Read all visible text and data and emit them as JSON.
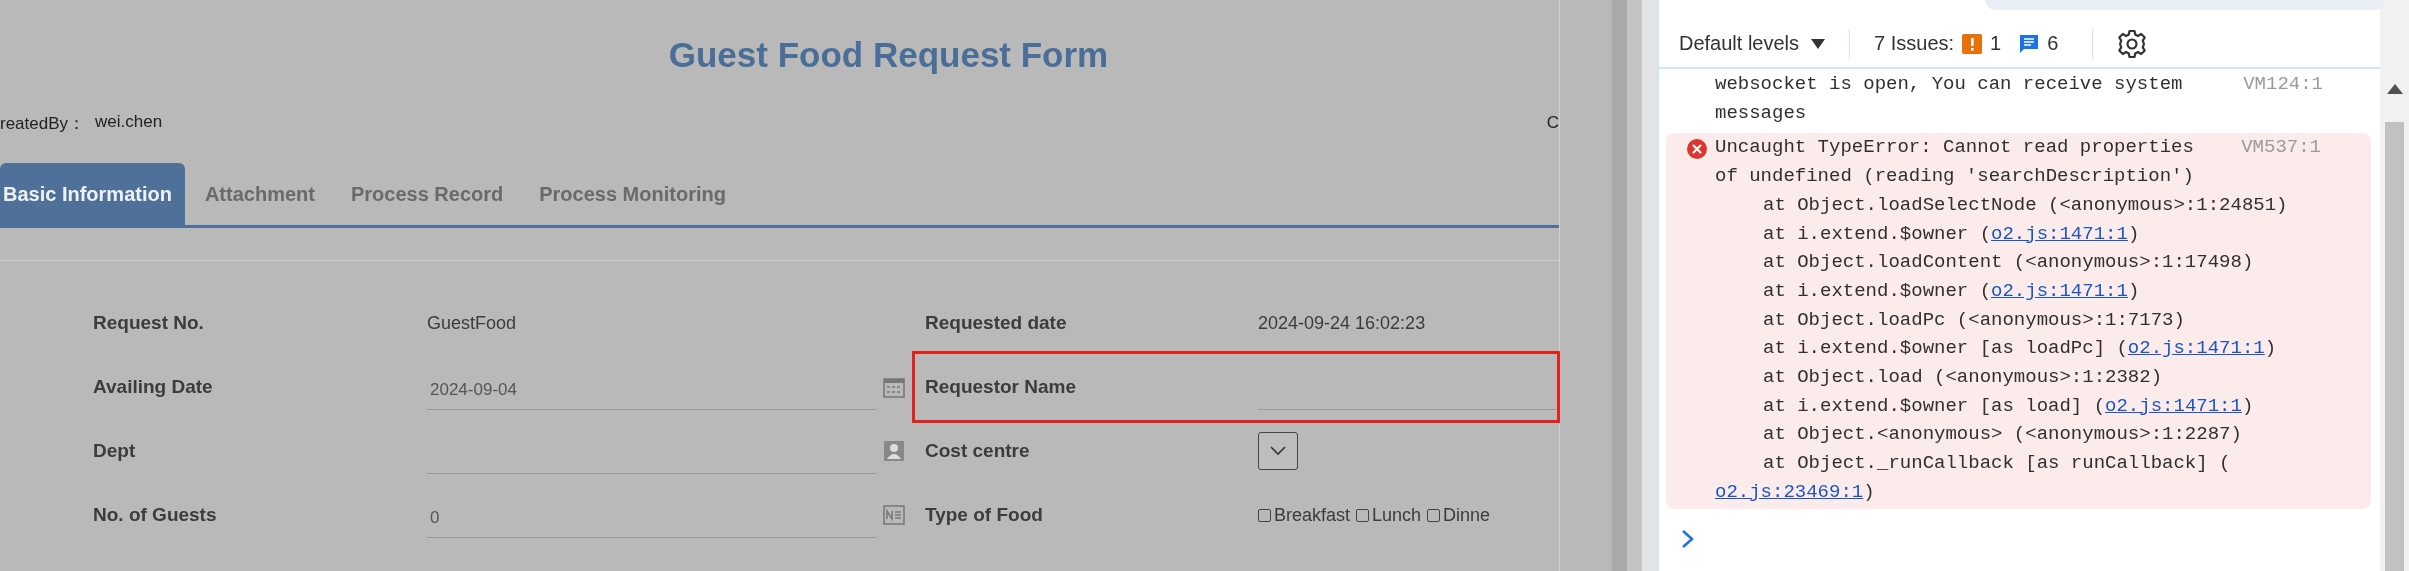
{
  "form": {
    "title": "Guest Food Request Form",
    "created_by": {
      "label": "reatedBy：",
      "value": "wei.chen"
    },
    "header_right": "C",
    "tabs": [
      {
        "label": "Basic Information",
        "selected": true
      },
      {
        "label": "Attachment",
        "selected": false
      },
      {
        "label": "Process Record",
        "selected": false
      },
      {
        "label": "Process Monitoring",
        "selected": false
      }
    ],
    "rows": [
      {
        "left": {
          "label": "Request No.",
          "kind": "text",
          "value": "GuestFood",
          "highlighted": false
        },
        "right": {
          "label": "Requested date",
          "kind": "text",
          "value": "2024-09-24 16:02:23",
          "highlighted": false
        }
      },
      {
        "left": {
          "label": "Availing Date",
          "kind": "date",
          "value": "2024-09-04",
          "highlighted": false
        },
        "right": {
          "label": "Requestor Name",
          "kind": "input",
          "highlighted": true
        }
      },
      {
        "left": {
          "label": "Dept",
          "kind": "person",
          "highlighted": false
        },
        "right": {
          "label": "Cost centre",
          "kind": "select",
          "highlighted": false
        }
      },
      {
        "left": {
          "label": "No. of Guests",
          "kind": "number",
          "value": "0",
          "highlighted": false
        },
        "right": {
          "label": "Type of Food",
          "kind": "checkboxes",
          "highlighted": false,
          "options": [
            {
              "label": "Breakfast",
              "checked": false
            },
            {
              "label": "Lunch",
              "checked": false
            },
            {
              "label": "Dinne",
              "checked": false
            }
          ]
        }
      }
    ]
  },
  "console": {
    "levels": "Default levels",
    "issues_label": "7 Issues:",
    "issue_counts": [
      {
        "kind": "warning",
        "count": "1"
      },
      {
        "kind": "info",
        "count": "6"
      }
    ],
    "messages": [
      {
        "kind": "log",
        "source": "VM124:1",
        "lines": [
          {
            "kind": "message",
            "parts": [
              {
                "text": "websocket is open, You can receive system"
              }
            ]
          },
          {
            "kind": "message",
            "parts": [
              {
                "text": "messages"
              }
            ]
          }
        ]
      },
      {
        "kind": "error",
        "source": "VM537:1",
        "lines": [
          {
            "kind": "message",
            "parts": [
              {
                "text": "Uncaught TypeError: Cannot read properties"
              }
            ]
          },
          {
            "kind": "message",
            "parts": [
              {
                "text": "of undefined (reading 'searchDescription')"
              }
            ]
          },
          {
            "kind": "frame",
            "parts": [
              {
                "text": "at Object.loadSelectNode (<anonymous>:1:24851)"
              }
            ]
          },
          {
            "kind": "frame",
            "parts": [
              {
                "text": "at i.extend.$owner ("
              },
              {
                "link": "o2.js:1471:1"
              },
              {
                "text": ")"
              }
            ]
          },
          {
            "kind": "frame",
            "parts": [
              {
                "text": "at Object.loadContent (<anonymous>:1:17498)"
              }
            ]
          },
          {
            "kind": "frame",
            "parts": [
              {
                "text": "at i.extend.$owner ("
              },
              {
                "link": "o2.js:1471:1"
              },
              {
                "text": ")"
              }
            ]
          },
          {
            "kind": "frame",
            "parts": [
              {
                "text": "at Object.loadPc (<anonymous>:1:7173)"
              }
            ]
          },
          {
            "kind": "frame",
            "parts": [
              {
                "text": "at i.extend.$owner [as loadPc] ("
              },
              {
                "link": "o2.js:1471:1"
              },
              {
                "text": ")"
              }
            ]
          },
          {
            "kind": "frame",
            "parts": [
              {
                "text": "at Object.load (<anonymous>:1:2382)"
              }
            ]
          },
          {
            "kind": "frame",
            "parts": [
              {
                "text": "at i.extend.$owner [as load] ("
              },
              {
                "link": "o2.js:1471:1"
              },
              {
                "text": ")"
              }
            ]
          },
          {
            "kind": "frame",
            "parts": [
              {
                "text": "at Object.<anonymous> (<anonymous>:1:2287)"
              }
            ]
          },
          {
            "kind": "frame",
            "parts": [
              {
                "text": "at Object._runCallback [as runCallback] ("
              }
            ]
          },
          {
            "kind": "wrap",
            "parts": [
              {
                "link": "o2.js:23469:1"
              },
              {
                "text": ")"
              }
            ]
          }
        ]
      }
    ]
  }
}
